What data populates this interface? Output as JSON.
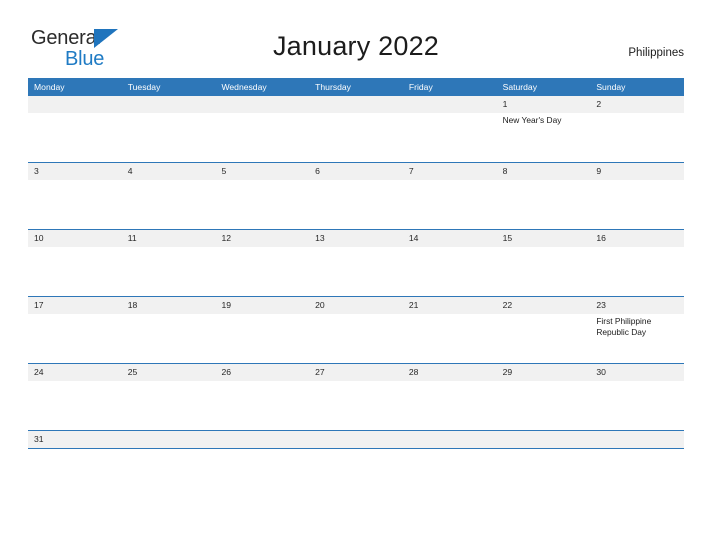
{
  "brand": {
    "name_part1": "General",
    "name_part2": "Blue",
    "flag_icon": "flag-triangle-icon",
    "color_dark": "#2b2b2b",
    "color_blue": "#1f7bc4"
  },
  "header": {
    "title": "January 2022",
    "country": "Philippines"
  },
  "theme": {
    "header_blue": "#2e77b8",
    "row_gray": "#f1f1f1",
    "text_dark": "#1c1c1c",
    "page_background": "#ffffff"
  },
  "calendar": {
    "month": "January",
    "year": "2022",
    "weekday_headers": [
      "Monday",
      "Tuesday",
      "Wednesday",
      "Thursday",
      "Friday",
      "Saturday",
      "Sunday"
    ],
    "weeks": [
      [
        {
          "date": "",
          "events": []
        },
        {
          "date": "",
          "events": []
        },
        {
          "date": "",
          "events": []
        },
        {
          "date": "",
          "events": []
        },
        {
          "date": "",
          "events": []
        },
        {
          "date": "1",
          "events": [
            "New Year's Day"
          ]
        },
        {
          "date": "2",
          "events": []
        }
      ],
      [
        {
          "date": "3",
          "events": []
        },
        {
          "date": "4",
          "events": []
        },
        {
          "date": "5",
          "events": []
        },
        {
          "date": "6",
          "events": []
        },
        {
          "date": "7",
          "events": []
        },
        {
          "date": "8",
          "events": []
        },
        {
          "date": "9",
          "events": []
        }
      ],
      [
        {
          "date": "10",
          "events": []
        },
        {
          "date": "11",
          "events": []
        },
        {
          "date": "12",
          "events": []
        },
        {
          "date": "13",
          "events": []
        },
        {
          "date": "14",
          "events": []
        },
        {
          "date": "15",
          "events": []
        },
        {
          "date": "16",
          "events": []
        }
      ],
      [
        {
          "date": "17",
          "events": []
        },
        {
          "date": "18",
          "events": []
        },
        {
          "date": "19",
          "events": []
        },
        {
          "date": "20",
          "events": []
        },
        {
          "date": "21",
          "events": []
        },
        {
          "date": "22",
          "events": []
        },
        {
          "date": "23",
          "events": [
            "First Philippine Republic Day"
          ]
        }
      ],
      [
        {
          "date": "24",
          "events": []
        },
        {
          "date": "25",
          "events": []
        },
        {
          "date": "26",
          "events": []
        },
        {
          "date": "27",
          "events": []
        },
        {
          "date": "28",
          "events": []
        },
        {
          "date": "29",
          "events": []
        },
        {
          "date": "30",
          "events": []
        }
      ],
      [
        {
          "date": "31",
          "events": []
        },
        {
          "date": "",
          "events": []
        },
        {
          "date": "",
          "events": []
        },
        {
          "date": "",
          "events": []
        },
        {
          "date": "",
          "events": []
        },
        {
          "date": "",
          "events": []
        },
        {
          "date": "",
          "events": []
        }
      ]
    ]
  }
}
